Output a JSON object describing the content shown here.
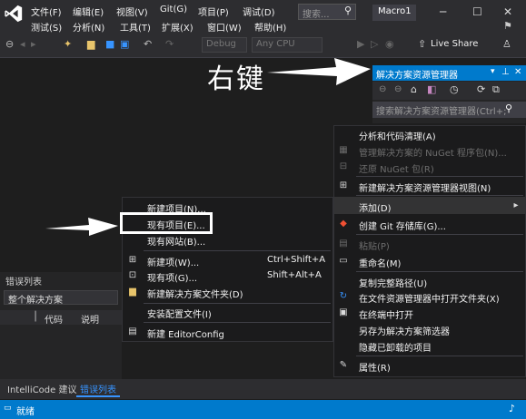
{
  "app": {
    "logo": "visual-studio-logo",
    "menu": [
      "文件(F)",
      "编辑(E)",
      "视图(V)",
      "Git(G)",
      "项目(P)",
      "调试(D)",
      "测试(S)",
      "分析(N)",
      "工具(T)",
      "扩展(X)",
      "窗口(W)",
      "帮助(H)"
    ],
    "search_placeholder": "搜索...",
    "solution_name": "Macro1"
  },
  "toolbar": {
    "config": "Debug",
    "platform": "Any CPU",
    "live_share": "Live Share"
  },
  "solution_explorer": {
    "title": "解决方案资源管理器",
    "search_placeholder": "搜索解决方案资源管理器(Ctrl+;"
  },
  "annotation": {
    "label": "右键",
    "arrow_color": "#ffffff",
    "highlight_box_color": "#ffffff"
  },
  "context_menu": {
    "items": [
      {
        "label": "分析和代码清理(A)",
        "icon": "",
        "enabled": true
      },
      {
        "label": "管理解决方案的 NuGet 程序包(N)...",
        "icon": "nuget-icon",
        "enabled": false
      },
      {
        "label": "还原 NuGet 包(R)",
        "icon": "restore-icon",
        "enabled": false
      },
      {
        "label": "新建解决方案资源管理器视图(N)",
        "icon": "new-view-icon",
        "enabled": true
      },
      {
        "label": "添加(D)",
        "icon": "",
        "enabled": true,
        "submenu": true
      },
      {
        "label": "创建 Git 存储库(G)...",
        "icon": "git-icon",
        "enabled": true
      },
      {
        "label": "粘贴(P)",
        "icon": "paste-icon",
        "enabled": false
      },
      {
        "label": "重命名(M)",
        "icon": "rename-icon",
        "enabled": true
      },
      {
        "label": "复制完整路径(U)",
        "icon": "",
        "enabled": true
      },
      {
        "label": "在文件资源管理器中打开文件夹(X)",
        "icon": "open-folder-icon",
        "enabled": true
      },
      {
        "label": "在终端中打开",
        "icon": "terminal-icon",
        "enabled": true
      },
      {
        "label": "另存为解决方案筛选器",
        "icon": "",
        "enabled": true
      },
      {
        "label": "隐藏已卸载的项目",
        "icon": "",
        "enabled": true
      },
      {
        "label": "属性(R)",
        "icon": "wrench-icon",
        "enabled": true
      }
    ]
  },
  "add_submenu": {
    "items": [
      {
        "label": "新建项目(N)...",
        "icon": "",
        "shortcut": ""
      },
      {
        "label": "现有项目(E)...",
        "icon": "",
        "shortcut": ""
      },
      {
        "label": "现有网站(B)...",
        "icon": "",
        "shortcut": ""
      },
      {
        "label": "新建项(W)...",
        "icon": "new-item-icon",
        "shortcut": "Ctrl+Shift+A"
      },
      {
        "label": "现有项(G)...",
        "icon": "existing-item-icon",
        "shortcut": "Shift+Alt+A"
      },
      {
        "label": "新建解决方案文件夹(D)",
        "icon": "new-folder-icon",
        "shortcut": ""
      },
      {
        "label": "安装配置文件(I)",
        "icon": "",
        "shortcut": ""
      },
      {
        "label": "新建 EditorConfig",
        "icon": "editorconfig-icon",
        "shortcut": ""
      }
    ]
  },
  "error_list": {
    "title": "错误列表",
    "scope": "整个解决方案",
    "columns": [
      "代码",
      "说明"
    ]
  },
  "bottom_tabs": [
    "IntelliCode 建议",
    "错误列表"
  ],
  "status": {
    "text": "就绪"
  }
}
